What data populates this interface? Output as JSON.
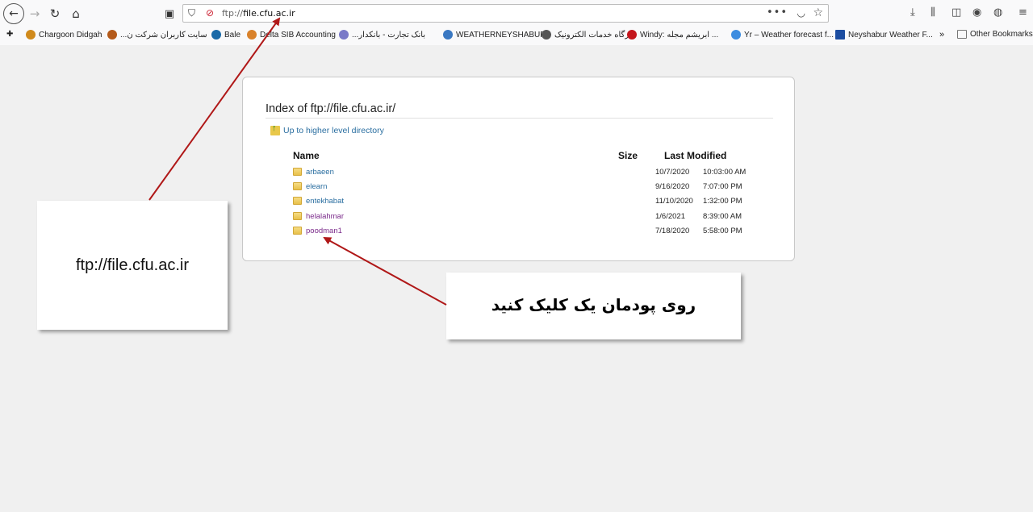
{
  "toolbar": {
    "back_icon": "←",
    "forward_icon": "→",
    "reload_icon": "↻",
    "home_icon": "⌂",
    "url_prefix": "ftp://",
    "url_host": "file.cfu.ac.ir",
    "more_icon": "•••"
  },
  "bookmarks": [
    {
      "label": "Chargoon Didgah",
      "color": "#d08a1c"
    },
    {
      "label": "سایت کاربران شرکت ن...",
      "color": "#b45a1a"
    },
    {
      "label": "Bale",
      "color": "#1a6aa8"
    },
    {
      "label": "Delta SIB Accounting",
      "color": "#d9822b"
    },
    {
      "label": "بانک تجارت - بانکدار...",
      "color": "#7a7ac8"
    },
    {
      "label": "WEATHERNEYSHABUR",
      "color": "#3a78c2"
    },
    {
      "label": "درگاه خدمات الکترونیک",
      "color": "#555555"
    },
    {
      "label": "Windy: ابریشم مجله ...",
      "color": "#c4161c"
    },
    {
      "label": "Yr – Weather forecast f...",
      "color": "#3d8de0"
    },
    {
      "label": "Neyshabur Weather F...",
      "color": "#1c4da1"
    },
    {
      "label": "Other Bookmarks",
      "color": "#777777"
    }
  ],
  "listing": {
    "title": "Index of ftp://file.cfu.ac.ir/",
    "up_link": "Up to higher level directory",
    "columns": {
      "name": "Name",
      "size": "Size",
      "modified": "Last Modified"
    },
    "rows": [
      {
        "name": "arbaeen",
        "date": "10/7/2020",
        "time": "10:03:00 AM"
      },
      {
        "name": "elearn",
        "date": "9/16/2020",
        "time": "7:07:00 PM"
      },
      {
        "name": "entekhabat",
        "date": "11/10/2020",
        "time": "1:32:00 PM"
      },
      {
        "name": "helalahmar",
        "date": "1/6/2021",
        "time": "8:39:00 AM"
      },
      {
        "name": "poodman1",
        "date": "7/18/2020",
        "time": "5:58:00 PM"
      }
    ]
  },
  "annotations": {
    "url_callout": "ftp://file.cfu.ac.ir",
    "click_callout": "روی پودمان یک کلیک کنید",
    "arrow_color": "#b01818"
  }
}
